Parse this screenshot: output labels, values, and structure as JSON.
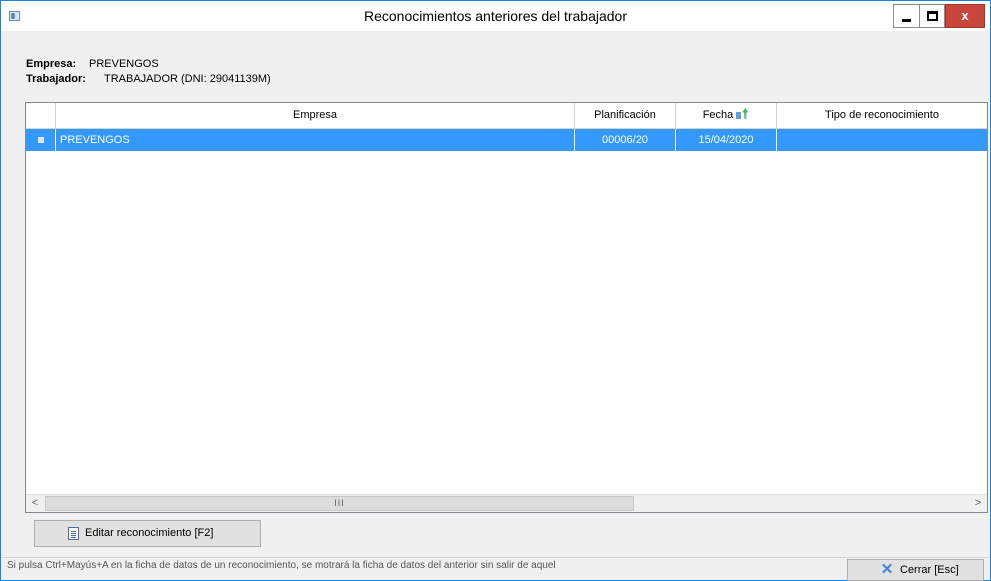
{
  "window": {
    "title": "Reconocimientos anteriores del trabajador",
    "minimize_label": "—",
    "maximize_label": "",
    "close_label": "x"
  },
  "info": {
    "empresa_label": "Empresa:",
    "empresa_value": "PREVENGOS",
    "trabajador_label": "Trabajador:",
    "trabajador_value": "TRABAJADOR (DNI: 29041139M)"
  },
  "grid": {
    "columns": [
      "Empresa",
      "Planificación",
      "Fecha",
      "Tipo de reconocimiento"
    ],
    "rows": [
      {
        "empresa": "PREVENGOS",
        "planificacion": "00006/20",
        "fecha": "15/04/2020",
        "tipo": ""
      }
    ],
    "scroll_left": "<",
    "scroll_right": ">",
    "scroll_thumb_grip": "III"
  },
  "actions": {
    "edit_label": "Editar reconocimiento  [F2]",
    "close_label": "Cerrar  [Esc]"
  },
  "status": {
    "message": "Si pulsa Ctrl+Mayús+A en la ficha de datos de un reconocimiento, se motrará la ficha de datos del anterior sin salir de aquel"
  },
  "icons": {
    "app": "window-icon",
    "sort": "sort-icon",
    "edit": "document-icon",
    "close": "close-x-icon"
  },
  "colors": {
    "selection": "#3399ff",
    "close_button": "#c9463d",
    "border_accent": "#1883d7"
  }
}
